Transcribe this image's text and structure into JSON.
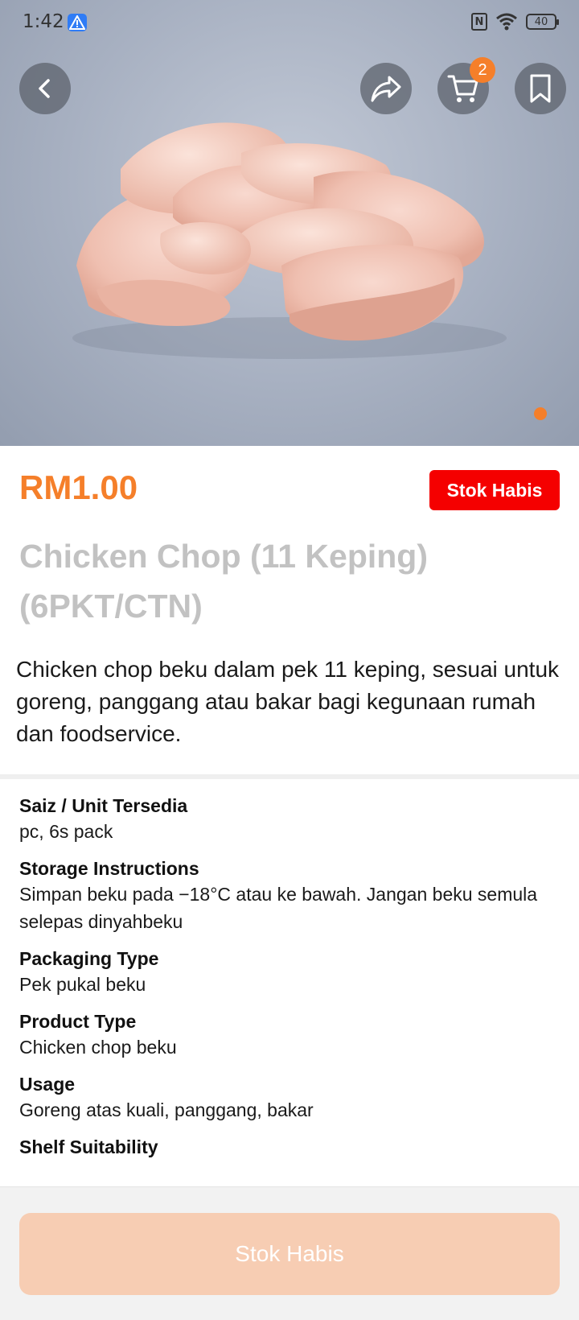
{
  "status_bar": {
    "time": "1:42",
    "battery": "40"
  },
  "header": {
    "cart_count": "2"
  },
  "product": {
    "price": "RM1.00",
    "stock_badge": "Stok Habis",
    "title": "Chicken Chop (11 Keping) (6PKT/CTN)",
    "description": "Chicken chop beku dalam pek 11 keping, sesuai untuk goreng, panggang atau bakar bagi kegunaan rumah dan foodservice."
  },
  "specs": [
    {
      "label": "Saiz / Unit Tersedia",
      "value": "pc, 6s pack"
    },
    {
      "label": "Storage Instructions",
      "value": "Simpan beku pada −18°C atau ke bawah. Jangan beku semula selepas dinyahbeku"
    },
    {
      "label": "Packaging Type",
      "value": "Pek pukal beku"
    },
    {
      "label": "Product Type",
      "value": "Chicken chop beku"
    },
    {
      "label": "Usage",
      "value": "Goreng atas kuali, panggang, bakar"
    },
    {
      "label": "Shelf Suitability",
      "value": ""
    }
  ],
  "bottom": {
    "cta_label": "Stok Habis"
  },
  "colors": {
    "accent": "#f57f2a",
    "out_of_stock": "#f50000",
    "cta_disabled": "#f7cdb3"
  },
  "icons": [
    "back-icon",
    "share-icon",
    "cart-icon",
    "bookmark-icon",
    "warning-icon",
    "wifi-icon",
    "nfc-icon"
  ]
}
